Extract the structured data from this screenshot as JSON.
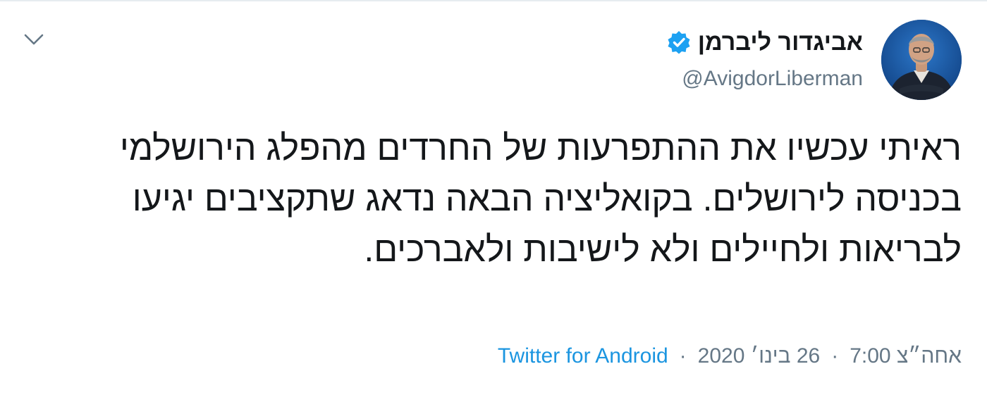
{
  "tweet": {
    "author": {
      "display_name": "אביגדור ליברמן",
      "handle": "@AvigdorLiberman",
      "verified_icon": "verified-badge-icon"
    },
    "text": "ראיתי עכשיו את ההתפרעות של החרדים מהפלג הירושלמי בכניסה לירושלים. בקואליציה הבאה נדאג שתקציבים יגיעו לבריאות ולחיילים ולא לישיבות ולאברכים.",
    "source": "Twitter for Android",
    "separator": "·",
    "date": "26 בינו׳ 2020",
    "time": "7:00 אחה״צ",
    "menu_icon": "chevron-down-icon"
  },
  "colors": {
    "text_primary": "#14171a",
    "text_secondary": "#657786",
    "link": "#1b95e0",
    "verified": "#1da1f2",
    "border": "#e6ecf0"
  }
}
